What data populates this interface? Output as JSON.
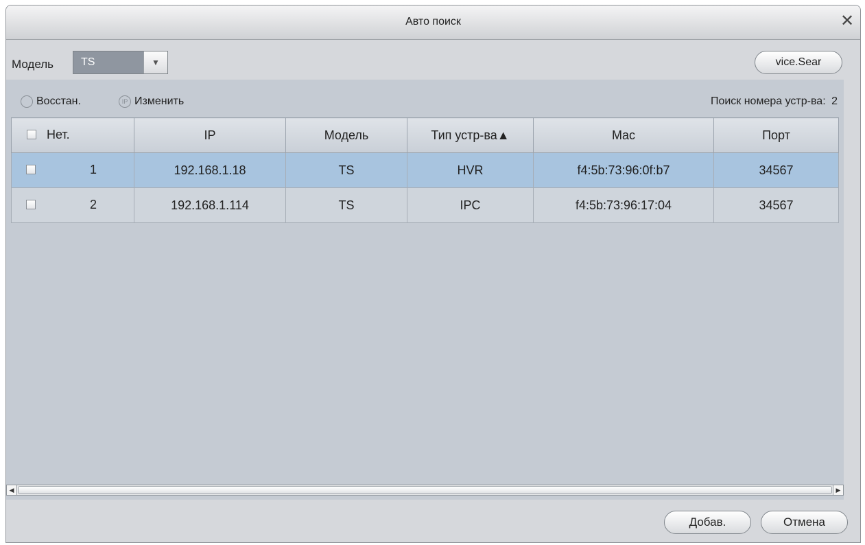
{
  "window": {
    "title": "Авто поиск",
    "close_glyph": "✕"
  },
  "filter": {
    "model_label": "Модель",
    "model_value": "TS",
    "dropdown_arrow": "▼",
    "search_button": "vice.Sear"
  },
  "toolbar": {
    "restore_label": "Восстан.",
    "restore_icon": "restore-icon",
    "modify_label": "Изменить",
    "modify_icon": "ip-icon",
    "modify_icon_text": "IP",
    "count_label": "Поиск номера устр-ва:",
    "count_value": "2"
  },
  "table": {
    "columns": [
      "Нет.",
      "IP",
      "Модель",
      "Тип устр-ва▲",
      "Mac",
      "Порт"
    ],
    "rows": [
      {
        "no": "1",
        "ip": "192.168.1.18",
        "model": "TS",
        "type": "HVR",
        "mac": "f4:5b:73:96:0f:b7",
        "port": "34567",
        "selected": true
      },
      {
        "no": "2",
        "ip": "192.168.1.114",
        "model": "TS",
        "type": "IPC",
        "mac": "f4:5b:73:96:17:04",
        "port": "34567",
        "selected": false
      }
    ]
  },
  "scrollbar": {
    "left_arrow": "◀",
    "right_arrow": "▶"
  },
  "buttons": {
    "add": "Добав.",
    "cancel": "Отмена"
  },
  "colors": {
    "selected_row": "#a8c4df",
    "panel_bg": "#c5cbd3",
    "dialog_bg": "#d6d8dc"
  }
}
